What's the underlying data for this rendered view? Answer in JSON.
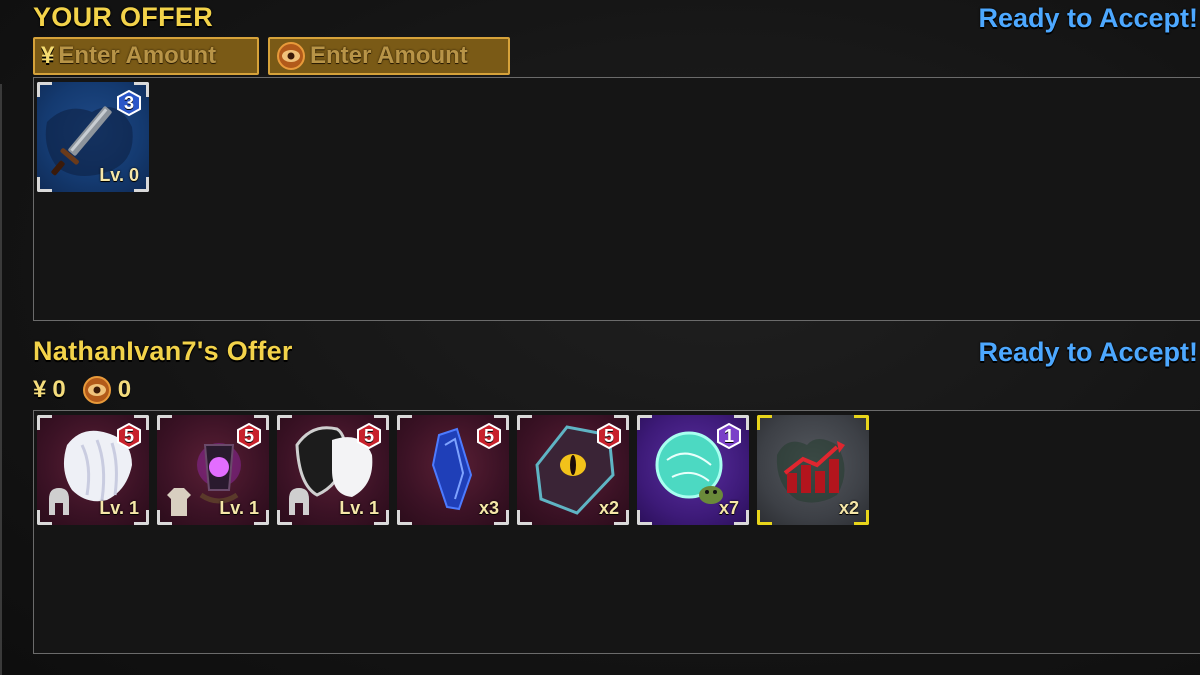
{
  "your_offer": {
    "title": "YOUR OFFER",
    "ready_label": "Ready to Accept!",
    "yen_symbol": "¥",
    "yen_placeholder": "Enter Amount",
    "eye_placeholder": "Enter Amount",
    "items": [
      {
        "icon": "sword-icon",
        "badge": "3",
        "label": "Lv. 0",
        "rarity": "rare"
      }
    ]
  },
  "their_offer": {
    "title": "NathanIvan7's Offer",
    "ready_label": "Ready to Accept!",
    "yen_symbol": "¥",
    "yen_amount": "0",
    "eye_amount": "0",
    "items": [
      {
        "icon": "white-fur-armor-icon",
        "badge": "5",
        "label": "Lv. 1",
        "type_icon": "helmet-icon",
        "rarity": "mythic"
      },
      {
        "icon": "dark-lantern-icon",
        "badge": "5",
        "label": "Lv. 1",
        "type_icon": "robe-icon",
        "rarity": "mythic"
      },
      {
        "icon": "monochrome-armor-icon",
        "badge": "5",
        "label": "Lv. 1",
        "type_icon": "helmet-icon",
        "rarity": "mythic"
      },
      {
        "icon": "blue-crystal-icon",
        "badge": "5",
        "label": "x3",
        "rarity": "mythic"
      },
      {
        "icon": "dragon-eye-scale-icon",
        "badge": "5",
        "label": "x2",
        "rarity": "mythic"
      },
      {
        "icon": "turtle-orb-icon",
        "badge": "1",
        "label": "x7",
        "rarity": "epic"
      },
      {
        "icon": "growth-chart-icon",
        "label": "x2",
        "rarity": "special"
      }
    ]
  },
  "colors": {
    "title_yellow": "#f3d34a",
    "ready_blue": "#4da8ff",
    "mythic_badge": "#c8222c",
    "epic_badge": "#7a3fc8",
    "rare_badge": "#2a56c8",
    "special_frame": "#e8d51b"
  }
}
